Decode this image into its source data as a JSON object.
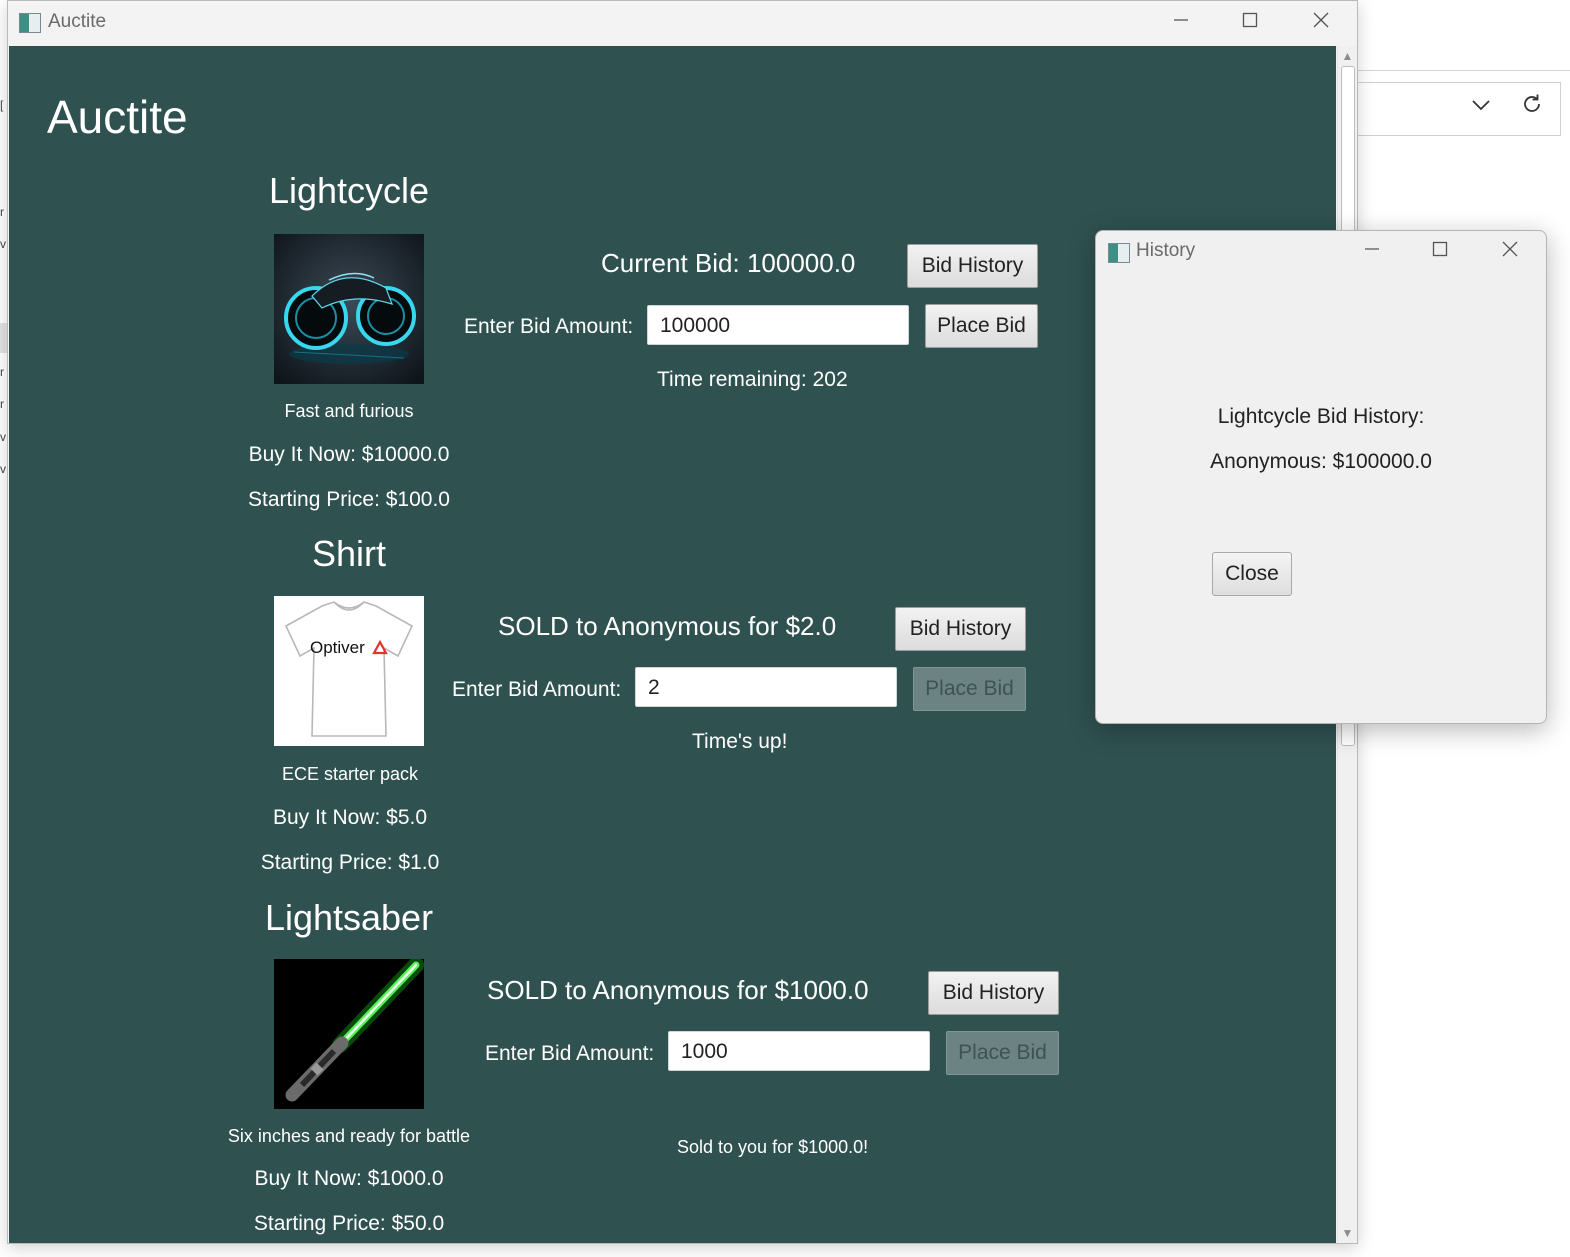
{
  "window": {
    "title": "Auctite",
    "minimize_glyph": "—",
    "maximize_glyph": "☐",
    "close_glyph": "✕"
  },
  "app": {
    "heading": "Auctite"
  },
  "items": [
    {
      "title": "Lightcycle",
      "description": "Fast and furious",
      "buy_it_now": "Buy It Now: $10000.0",
      "starting_price": "Starting Price: $100.0",
      "status": "Current Bid: 100000.0",
      "bid_history_label": "Bid History",
      "enter_bid_label": "Enter Bid Amount:",
      "bid_value": "100000",
      "place_bid_label": "Place Bid",
      "place_bid_enabled": true,
      "timer": "Time remaining: 202",
      "note": ""
    },
    {
      "title": "Shirt",
      "description": "ECE starter pack",
      "buy_it_now": "Buy It Now: $5.0",
      "starting_price": "Starting Price: $1.0",
      "status": "SOLD to Anonymous for $2.0",
      "bid_history_label": "Bid History",
      "enter_bid_label": "Enter Bid Amount:",
      "bid_value": "2",
      "place_bid_label": "Place Bid",
      "place_bid_enabled": false,
      "timer": "Time's up!",
      "note": "",
      "image_text": "Optiver"
    },
    {
      "title": "Lightsaber",
      "description": "Six inches and ready for battle",
      "buy_it_now": "Buy It Now: $1000.0",
      "starting_price": "Starting Price: $50.0",
      "status": "SOLD to Anonymous for $1000.0",
      "bid_history_label": "Bid History",
      "enter_bid_label": "Enter Bid Amount:",
      "bid_value": "1000",
      "place_bid_label": "Place Bid",
      "place_bid_enabled": false,
      "timer": "",
      "note": "Sold to you for $1000.0!"
    }
  ],
  "history_dialog": {
    "title": "History",
    "heading": "Lightcycle Bid History:",
    "entries": [
      "Anonymous: $100000.0"
    ],
    "close_label": "Close"
  },
  "background_window": {
    "dropdown_icon": "chevron-down-icon",
    "refresh_icon": "refresh-icon"
  },
  "colors": {
    "content_bg": "#2f5150",
    "disabled_button": "#6b8483"
  }
}
